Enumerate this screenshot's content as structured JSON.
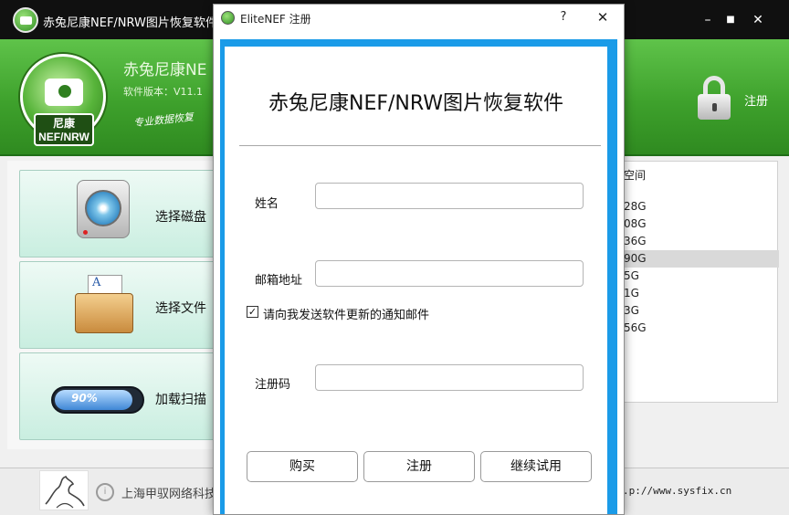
{
  "main_window": {
    "title": "赤兔尼康NEF/NRW图片恢复软件",
    "minimize_glyph": "–",
    "maximize_glyph": "■",
    "close_glyph": "✕",
    "header": {
      "product_name": "赤兔尼康NE",
      "version": "软件版本：V11.1",
      "logo_badge_line1": "尼康",
      "logo_badge_line2": "NEF/NRW",
      "slogan": "专业数据恢复",
      "register_label": "注册"
    },
    "menu": [
      {
        "label": "选择磁盘",
        "icon": "hard-disk-icon"
      },
      {
        "label": "选择文件",
        "icon": "folder-icon"
      },
      {
        "label": "加载扫描",
        "icon": "progress-icon",
        "progress_text": "90%",
        "progress": 0.9
      }
    ],
    "disk_list": {
      "header": "空间",
      "rows": [
        "28G",
        "08G",
        "36G",
        "90G",
        "5G",
        "1G",
        "3G",
        "56G"
      ],
      "selected_index": 3
    },
    "footer": {
      "company": "上海甲驭网络科技",
      "url": ".p://www.sysfix.cn"
    }
  },
  "dialog": {
    "title": "EliteNEF 注册",
    "help_glyph": "?",
    "close_glyph": "✕",
    "heading": "赤兔尼康NEF/NRW图片恢复软件",
    "name_label": "姓名",
    "name_value": "",
    "email_label": "邮箱地址",
    "email_value": "",
    "newsletter_label": "请向我发送软件更新的通知邮件",
    "newsletter_checked": true,
    "code_label": "注册码",
    "code_value": "",
    "buy_label": "购买",
    "register_label": "注册",
    "trial_label": "继续试用"
  },
  "colors": {
    "header_green": "#3ea12c",
    "dialog_frame_blue": "#1a9be8",
    "titlebar_dark": "#101010"
  }
}
